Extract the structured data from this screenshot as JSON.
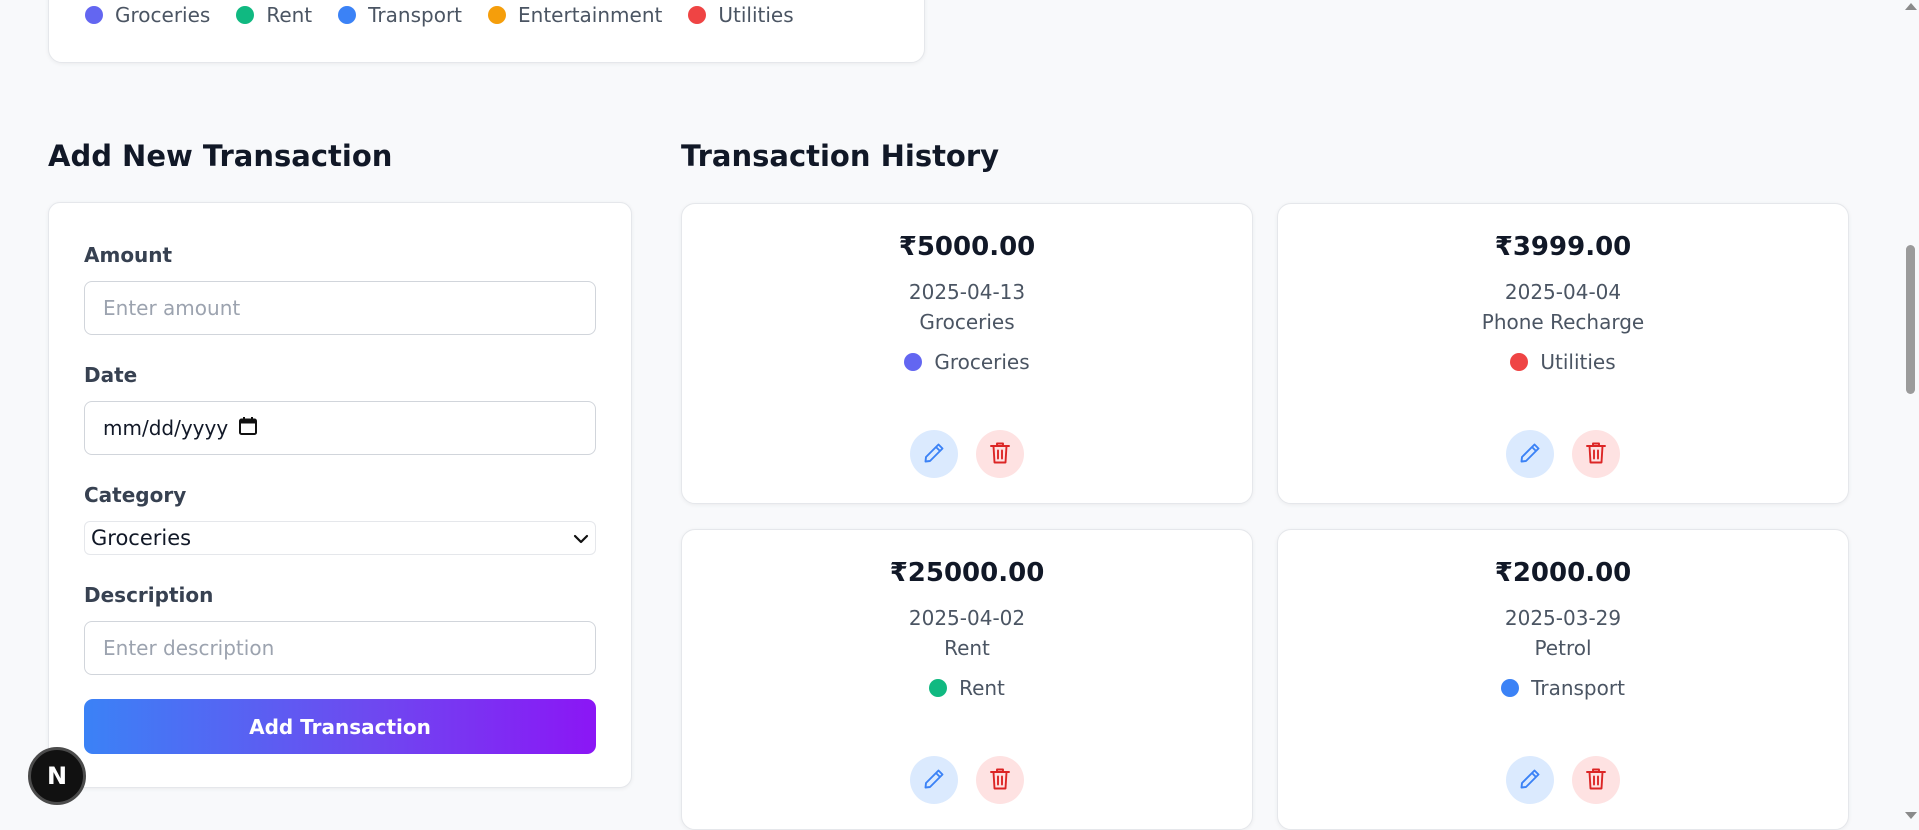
{
  "legend": {
    "items": [
      {
        "label": "Groceries",
        "color": "#6366f1"
      },
      {
        "label": "Rent",
        "color": "#10b981"
      },
      {
        "label": "Transport",
        "color": "#3b82f6"
      },
      {
        "label": "Entertainment",
        "color": "#f59e0b"
      },
      {
        "label": "Utilities",
        "color": "#ef4444"
      }
    ]
  },
  "form": {
    "title": "Add New Transaction",
    "amount_label": "Amount",
    "amount_placeholder": "Enter amount",
    "date_label": "Date",
    "date_placeholder": "mm/dd/yyyy",
    "category_label": "Category",
    "category_selected": "Groceries",
    "description_label": "Description",
    "description_placeholder": "Enter description",
    "submit_label": "Add Transaction"
  },
  "history": {
    "title": "Transaction History",
    "transactions": [
      {
        "amount": "₹5000.00",
        "date": "2025-04-13",
        "description": "Groceries",
        "category": "Groceries",
        "category_color": "#6366f1"
      },
      {
        "amount": "₹3999.00",
        "date": "2025-04-04",
        "description": "Phone Recharge",
        "category": "Utilities",
        "category_color": "#ef4444"
      },
      {
        "amount": "₹25000.00",
        "date": "2025-04-02",
        "description": "Rent",
        "category": "Rent",
        "category_color": "#10b981"
      },
      {
        "amount": "₹2000.00",
        "date": "2025-03-29",
        "description": "Petrol",
        "category": "Transport",
        "category_color": "#3b82f6"
      }
    ]
  },
  "badge": {
    "label": "N"
  },
  "colors": {
    "accent_start": "#3b82f6",
    "accent_end": "#8b16f5",
    "edit_icon": "#3b82f6",
    "delete_icon": "#dc2626"
  }
}
